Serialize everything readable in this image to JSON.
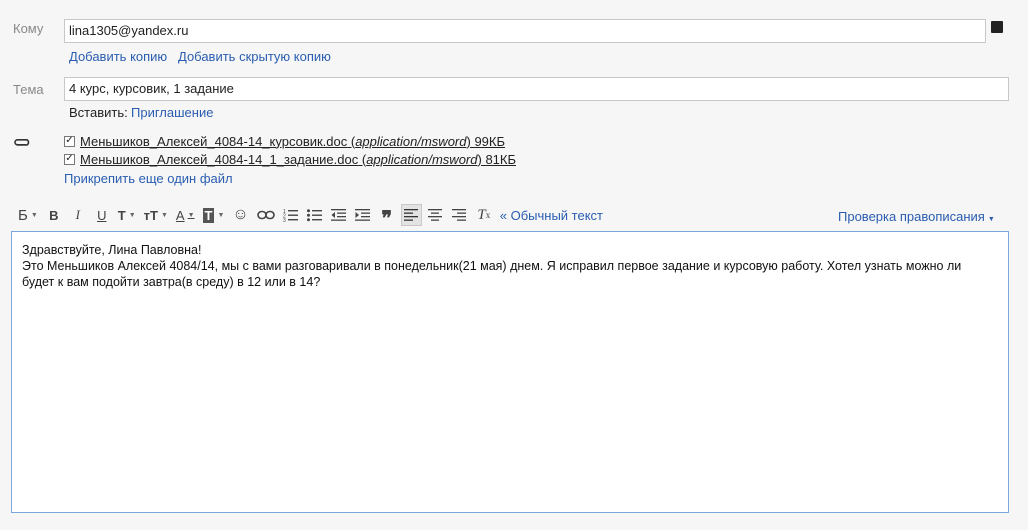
{
  "to": {
    "label": "Кому",
    "value": "lina1305@yandex.ru",
    "add_cc": "Добавить копию",
    "add_bcc": "Добавить скрытую копию"
  },
  "subject": {
    "label": "Тема",
    "value": "4 курс, курсовик, 1 задание",
    "insert_label": "Вставить:",
    "insert_link": "Приглашение"
  },
  "attachments": {
    "items": [
      {
        "name": "Меньшиков_Алексей_4084-14_курсовик.doc",
        "mime": "application/msword",
        "size": "99КБ",
        "checked": true
      },
      {
        "name": "Меньшиков_Алексей_4084-14_1_задание.doc",
        "mime": "application/msword",
        "size": "81КБ",
        "checked": true
      }
    ],
    "attach_more": "Прикрепить еще один файл"
  },
  "toolbar": {
    "bold_letter": "Б",
    "b": "B",
    "i": "I",
    "u": "U",
    "font": "T",
    "size": "тT",
    "color": "A",
    "bg": "T",
    "plain_text": "« Обычный текст",
    "spellcheck": "Проверка правописания"
  },
  "body": {
    "lines": [
      "Здравствуйте, Лина Павловна!",
      "Это Меньшиков Алексей 4084/14, мы с вами разговаривали в понедельник(21 мая) днем. Я исправил первое задание и курсовую работу. Хотел узнать можно ли",
      "будет к вам подойти завтра(в среду) в 12 или в 14?"
    ]
  }
}
